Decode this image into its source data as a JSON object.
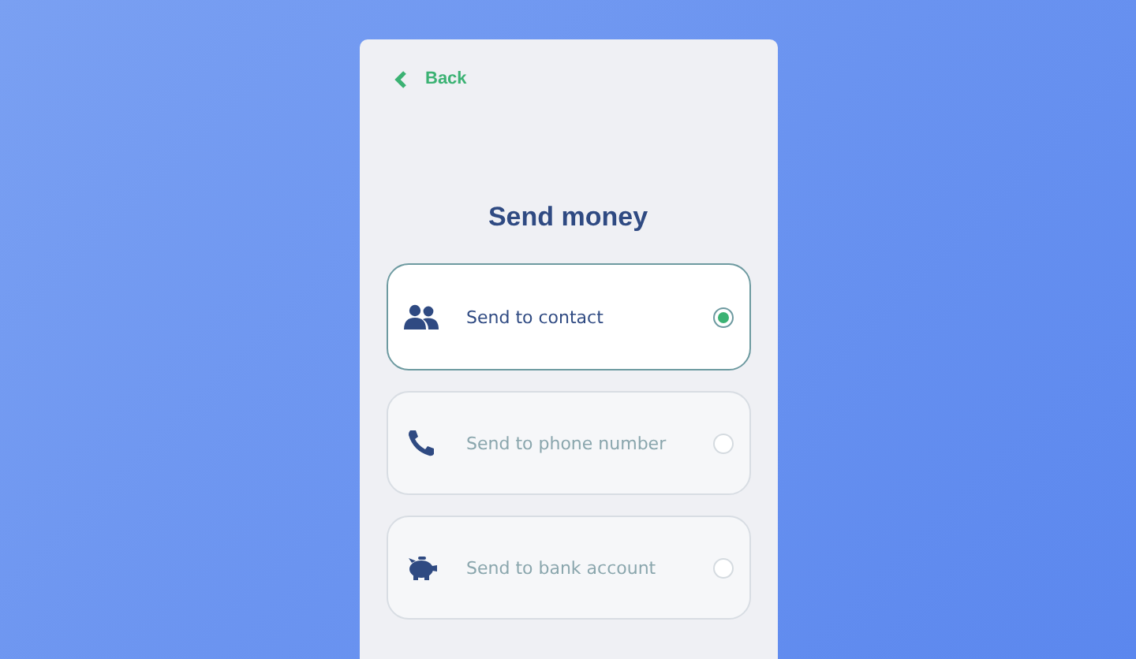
{
  "back": {
    "label": "Back"
  },
  "title": "Send money",
  "options": [
    {
      "kind": "contact",
      "label": "Send to contact",
      "selected": true
    },
    {
      "kind": "phone",
      "label": "Send to phone number",
      "selected": false
    },
    {
      "kind": "bank",
      "label": "Send to bank account",
      "selected": false
    }
  ]
}
